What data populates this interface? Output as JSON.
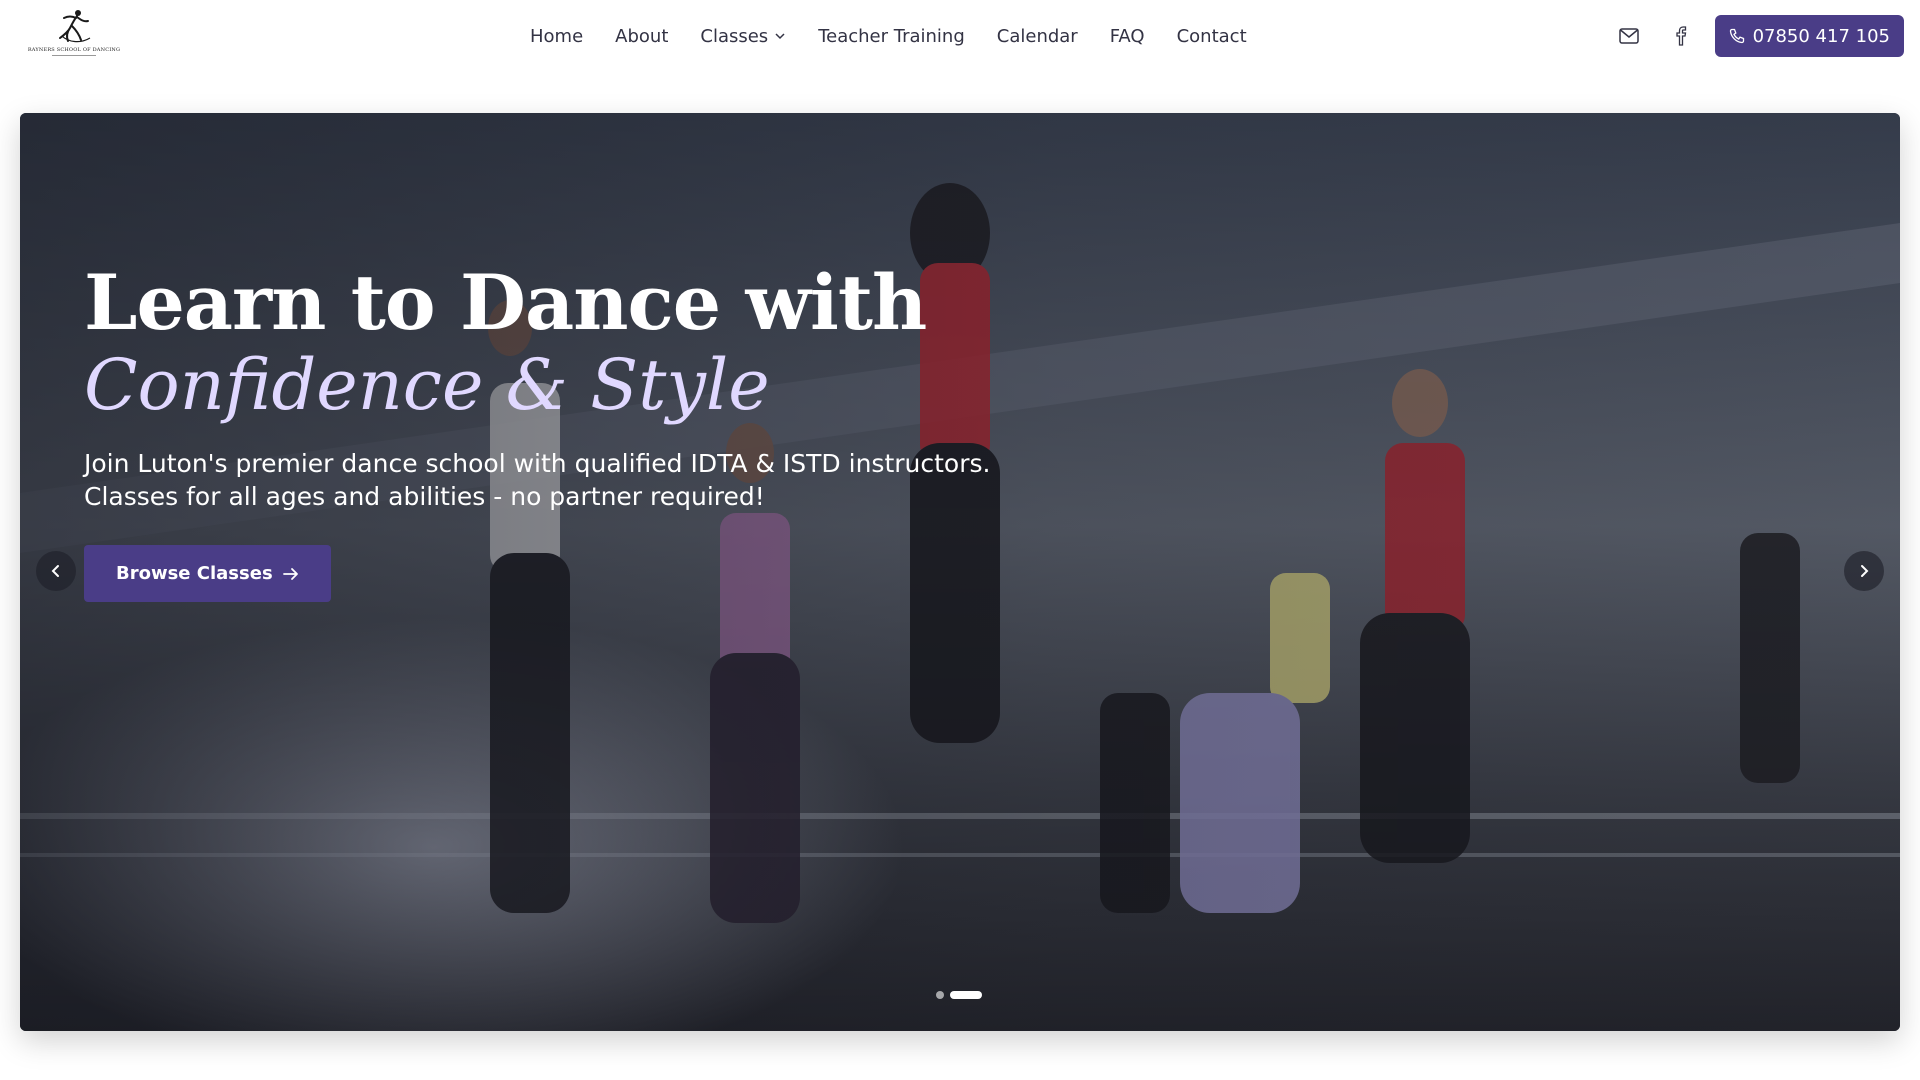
{
  "brand": {
    "logo_text": "RAYNERS SCHOOL OF DANCING",
    "logo_icon": "dancer-silhouette-icon"
  },
  "nav": {
    "items": [
      {
        "label": "Home"
      },
      {
        "label": "About"
      },
      {
        "label": "Classes",
        "has_dropdown": true
      },
      {
        "label": "Teacher Training"
      },
      {
        "label": "Calendar"
      },
      {
        "label": "FAQ"
      },
      {
        "label": "Contact"
      }
    ]
  },
  "header_actions": {
    "email_icon": "mail-icon",
    "facebook_icon": "facebook-icon",
    "phone_icon": "phone-icon",
    "phone_label": "07850 417 105"
  },
  "hero": {
    "title_line1": "Learn to Dance with",
    "title_line2": "Confidence & Style",
    "text_line1": "Join Luton's premier dance school with qualified IDTA & ISTD instructors.",
    "text_line2": "Classes for all ages and abilities - no partner required!",
    "cta_label": "Browse Classes",
    "cta_icon": "arrow-right-icon",
    "prev_icon": "chevron-left-icon",
    "next_icon": "chevron-right-icon",
    "slides_total": 2,
    "active_slide": 2
  },
  "colors": {
    "accent": "#4a3d87",
    "script_title": "#e0d8ff",
    "nav_text": "#333344"
  }
}
